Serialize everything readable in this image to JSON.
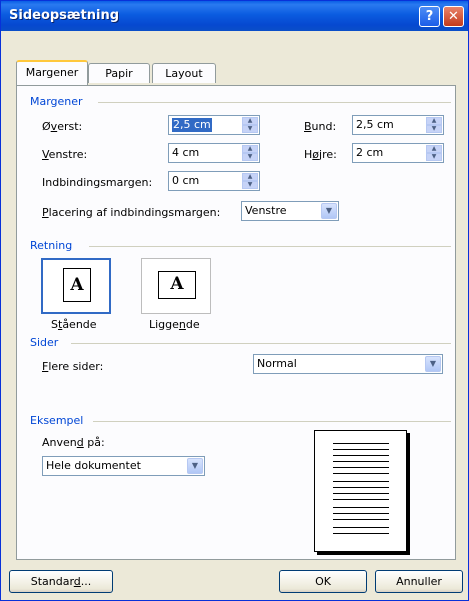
{
  "window": {
    "title": "Sideopsætning",
    "help_label": "?",
    "close_label": "✕"
  },
  "tabs": [
    {
      "label": "Margener"
    },
    {
      "label": "Papir"
    },
    {
      "label": "Layout"
    }
  ],
  "margins": {
    "section_label": "Margener",
    "top": {
      "label_pre": "Ø",
      "label_u": "v",
      "label_post": "erst:",
      "value": "2,5 cm"
    },
    "bottom": {
      "label_pre": "",
      "label_u": "B",
      "label_post": "und:",
      "value": "2,5 cm"
    },
    "left": {
      "label_pre": "",
      "label_u": "V",
      "label_post": "enstre:",
      "value": "4 cm"
    },
    "right": {
      "label_pre": "H",
      "label_u": "ø",
      "label_post": "jre:",
      "value": "2 cm"
    },
    "gutter": {
      "label": "Indbindingsmargen:",
      "value": "0 cm"
    },
    "gutter_pos": {
      "label_pre": "",
      "label_u": "P",
      "label_post": "lacering af indbindingsmargen:",
      "value": "Venstre"
    }
  },
  "orientation": {
    "section_label": "Retning",
    "portrait": {
      "label_pre": "S",
      "label_u": "t",
      "label_post": "ående",
      "glyph": "A"
    },
    "landscape": {
      "label_pre": "Ligge",
      "label_u": "n",
      "label_post": "de",
      "glyph": "A"
    }
  },
  "pages": {
    "section_label": "Sider",
    "multiple": {
      "label_pre": "",
      "label_u": "F",
      "label_post": "lere sider:",
      "value": "Normal"
    }
  },
  "preview": {
    "section_label": "Eksempel",
    "apply_label_pre": "Anven",
    "apply_label_u": "d",
    "apply_label_post": " på:",
    "apply_value": "Hele dokumentet"
  },
  "buttons": {
    "default_pre": "Standar",
    "default_u": "d",
    "default_post": "...",
    "ok": "OK",
    "cancel": "Annuller"
  }
}
